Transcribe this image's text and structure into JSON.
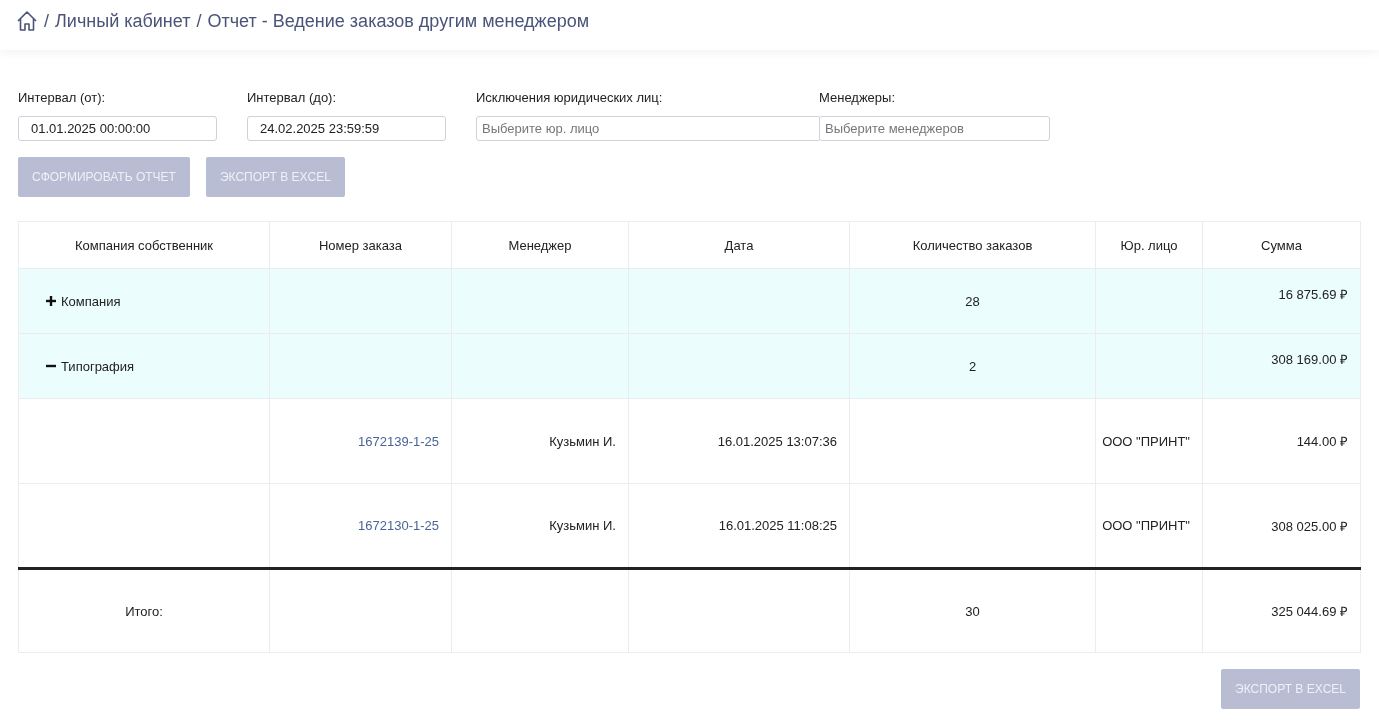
{
  "breadcrumb": {
    "items": [
      "Личный кабинет",
      "Отчет - Ведение заказов другим менеджером"
    ],
    "separator": "/"
  },
  "filters": [
    {
      "label": "Интервал (от):",
      "value": "01.01.2025 00:00:00",
      "kind": "date"
    },
    {
      "label": "Интервал (до):",
      "value": "24.02.2025 23:59:59",
      "kind": "date"
    },
    {
      "label": "Исключения юридических лиц:",
      "placeholder": "Выберите юр. лицо",
      "kind": "select"
    },
    {
      "label": "Менеджеры:",
      "placeholder": "Выберите менеджеров",
      "kind": "select"
    }
  ],
  "actions": [
    {
      "label": "СФОРМИРОВАТЬ ОТЧЕТ",
      "disabled": true
    },
    {
      "label": "ЭКСПОРТ В EXCEL",
      "disabled": true
    }
  ],
  "table": {
    "columns": [
      "Компания собственник",
      "Номер заказа",
      "Менеджер",
      "Дата",
      "Количество заказов",
      "Юр. лицо",
      "Сумма"
    ],
    "rows": [
      {
        "kind": "group",
        "name": "Компания",
        "expanded": false,
        "count": "28",
        "sum": "16 875.69 ₽"
      },
      {
        "kind": "group",
        "name": "Типография",
        "expanded": true,
        "count": "2",
        "sum": "308 169.00 ₽"
      },
      {
        "kind": "order",
        "number": "1672139-1-25",
        "manager": "Кузьмин И.",
        "date": "16.01.2025 13:07:36",
        "entity": "ООО \"ПРИНТ\"",
        "sum": "144.00 ₽"
      },
      {
        "kind": "order",
        "number": "1672130-1-25",
        "manager": "Кузьмин И.",
        "date": "16.01.2025 11:08:25",
        "entity": "ООО \"ПРИНТ\"",
        "sum": "308 025.00 ₽"
      }
    ],
    "total": {
      "label": "Итого:",
      "count": "30",
      "sum": "325 044.69 ₽"
    }
  },
  "footer_button": {
    "label": "ЭКСПОРТ В EXCEL",
    "disabled": true
  }
}
